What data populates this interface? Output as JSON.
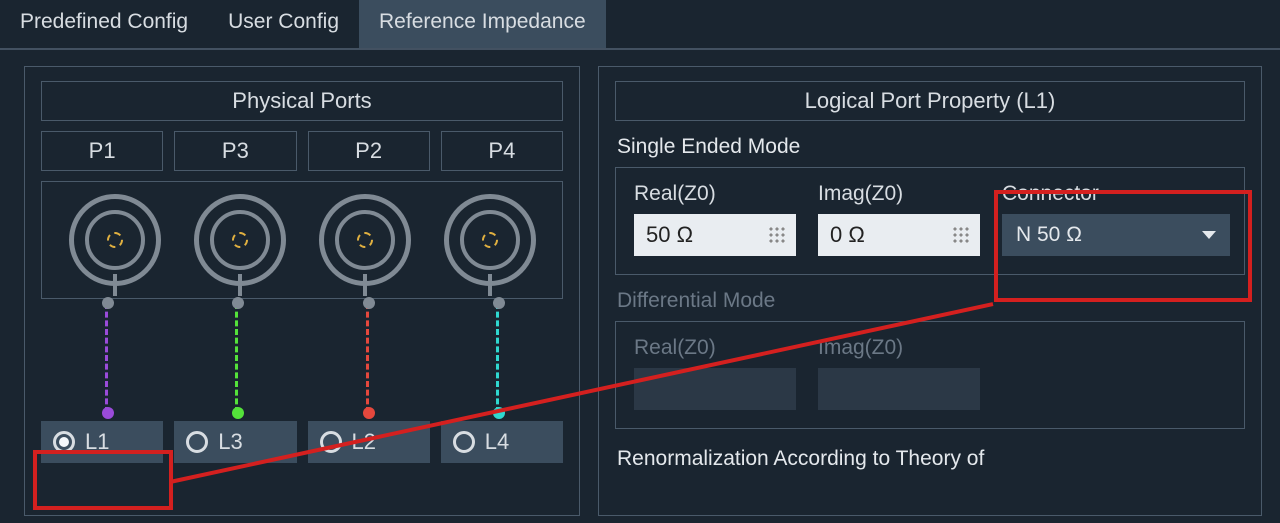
{
  "tabs": {
    "predefined": "Predefined Config",
    "user": "User Config",
    "reference": "Reference Impedance"
  },
  "left": {
    "title": "Physical Ports",
    "ports": [
      "P1",
      "P3",
      "P2",
      "P4"
    ],
    "logical": [
      "L1",
      "L3",
      "L2",
      "L4"
    ],
    "selected_logical": "L1"
  },
  "right": {
    "title": "Logical Port Property (L1)",
    "single_mode_label": "Single Ended Mode",
    "real_label": "Real(Z0)",
    "imag_label": "Imag(Z0)",
    "connector_label": "Connector",
    "real_value": "50 Ω",
    "imag_value": "0 Ω",
    "connector_value": "N 50 Ω",
    "diff_mode_label": "Differential Mode",
    "diff_real_label": "Real(Z0)",
    "diff_imag_label": "Imag(Z0)",
    "renorm_label": "Renormalization According to Theory of"
  }
}
